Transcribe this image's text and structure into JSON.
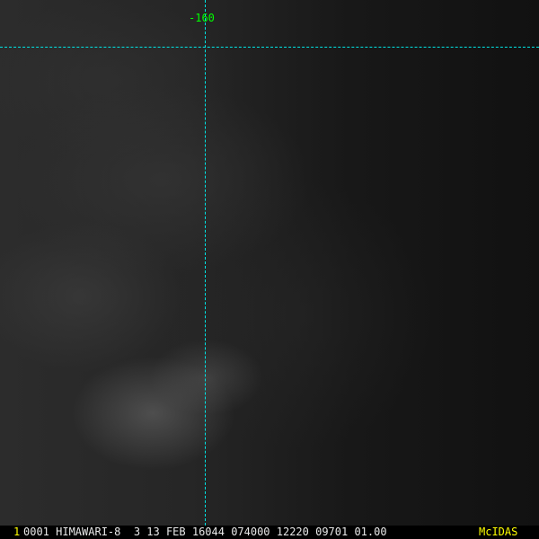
{
  "map": {
    "longitude_label": "-160",
    "grid_color": "#00e5e5",
    "label_color": "#00ff00"
  },
  "status_bar": {
    "frame_number": "1",
    "info": "0001 HIMAWARI-8  3 13 FEB 16044 074000 12220 09701 01.00",
    "brand": "McIDAS",
    "accent_color": "#ffff00"
  }
}
